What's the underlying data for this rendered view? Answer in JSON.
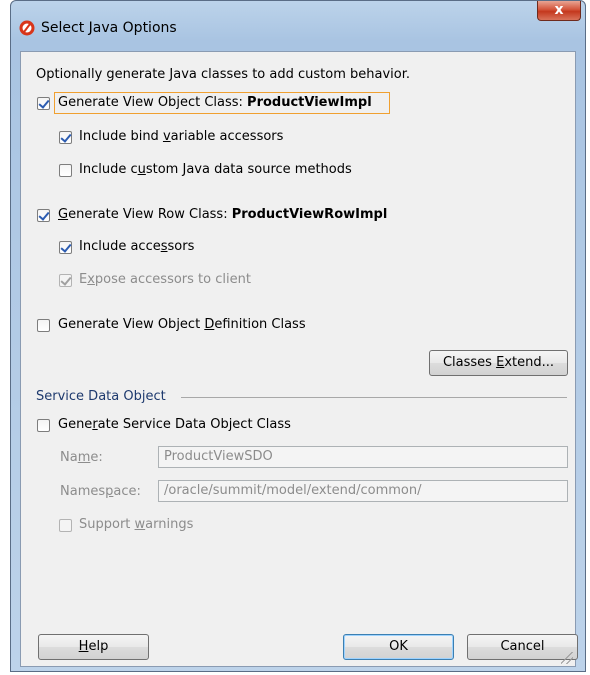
{
  "window": {
    "title": "Select Java Options",
    "close_label": "x"
  },
  "intro": "Optionally generate Java classes to add custom behavior.",
  "view_object": {
    "generate_label_pre": "Generate View Ob",
    "generate_label_mn": "j",
    "generate_label_post": "ect Class: ",
    "class_name": "ProductViewImpl",
    "checked": true,
    "bind_pre": "Include bind ",
    "bind_mn": "v",
    "bind_post": "ariable accessors",
    "bind_checked": true,
    "custom_pre": "Include c",
    "custom_mn": "u",
    "custom_post": "stom Java data source methods",
    "custom_checked": false
  },
  "view_row": {
    "generate_mn": "G",
    "generate_post": "enerate View Row Class: ",
    "class_name": "ProductViewRowImpl",
    "checked": true,
    "accessors_pre": "Include acce",
    "accessors_mn": "s",
    "accessors_post": "sors",
    "accessors_checked": true,
    "expose_pre": "E",
    "expose_mn": "x",
    "expose_post": "pose accessors to client",
    "expose_checked": true,
    "expose_disabled": true
  },
  "definition": {
    "label_pre": "Generate View Object ",
    "label_mn": "D",
    "label_post": "efinition Class",
    "checked": false
  },
  "classes_extend_button": {
    "pre": "Classes ",
    "mn": "E",
    "post": "xtend..."
  },
  "sdo": {
    "section_title": "Service Data Object",
    "generate_pre": "Gene",
    "generate_mn": "r",
    "generate_post": "ate Service Data Object Class",
    "checked": false,
    "name_label_pre": "Na",
    "name_label_mn": "m",
    "name_label_post": "e:",
    "name_value": "ProductViewSDO",
    "namespace_label_pre": "Names",
    "namespace_label_mn": "p",
    "namespace_label_post": "ace:",
    "namespace_value": "/oracle/summit/model/extend/common/",
    "warnings_pre": "Support ",
    "warnings_mn": "w",
    "warnings_post": "arnings",
    "warnings_checked": false
  },
  "footer": {
    "help_mn": "H",
    "help_post": "elp",
    "ok_label": "OK",
    "cancel_label": "Cancel"
  }
}
